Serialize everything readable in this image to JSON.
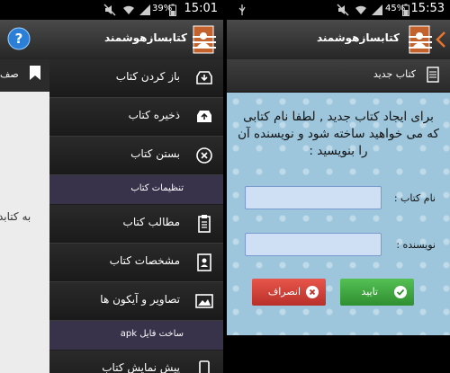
{
  "left_screen": {
    "status": {
      "battery_pct": "39%",
      "time": "15:01"
    },
    "app_title": "کتابسازهوشمند",
    "behind_header_text": "صف",
    "behind_body_text": "به کتابد",
    "menu": [
      {
        "label": "باز کردن کتاب",
        "icon": "open-book-icon"
      },
      {
        "label": "ذخیره کتاب",
        "icon": "save-icon"
      },
      {
        "label": "بستن کتاب",
        "icon": "close-circle-icon"
      }
    ],
    "section_settings": "تنظیمات کتاب",
    "settings_items": [
      {
        "label": "مطالب کتاب",
        "icon": "clipboard-icon"
      },
      {
        "label": "مشخصات کتاب",
        "icon": "contact-book-icon"
      },
      {
        "label": "تصاویر و آیکون ها",
        "icon": "image-icon"
      }
    ],
    "section_apk": "ساخت فایل apk",
    "apk_items": [
      {
        "label": "پیش نمایش کتاب",
        "icon": "phone-icon"
      }
    ]
  },
  "right_screen": {
    "status": {
      "battery_pct": "45%",
      "time": "15:53"
    },
    "app_title": "کتابسازهوشمند",
    "page_title": "کتاب جدید",
    "instructions": "برای ایجاد کتاب جدید , لطفا نام کتابی که می خواهید ساخته شود و نویسنده آن را بنویسید :",
    "fields": [
      {
        "label": "نام کتاب :",
        "value": ""
      },
      {
        "label": "نویسنده :",
        "value": ""
      }
    ],
    "confirm_label": "تایید",
    "cancel_label": "انصراف"
  },
  "colors": {
    "confirm": "#3fa53f",
    "cancel": "#d9423a",
    "section": "#38324a",
    "content_bg": "#9dc6dc"
  }
}
